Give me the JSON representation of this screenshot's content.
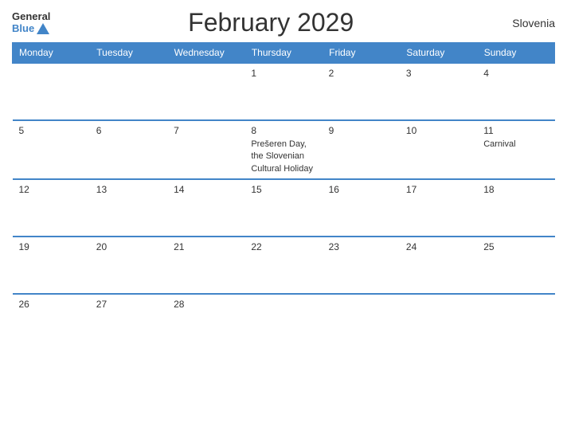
{
  "header": {
    "logo": {
      "general": "General",
      "blue": "Blue"
    },
    "title": "February 2029",
    "country": "Slovenia"
  },
  "calendar": {
    "days_of_week": [
      "Monday",
      "Tuesday",
      "Wednesday",
      "Thursday",
      "Friday",
      "Saturday",
      "Sunday"
    ],
    "weeks": [
      [
        {
          "day": "",
          "empty": true
        },
        {
          "day": "",
          "empty": true
        },
        {
          "day": "",
          "empty": true
        },
        {
          "day": "1",
          "empty": false,
          "event": ""
        },
        {
          "day": "2",
          "empty": false,
          "event": ""
        },
        {
          "day": "3",
          "empty": false,
          "event": ""
        },
        {
          "day": "4",
          "empty": false,
          "event": ""
        }
      ],
      [
        {
          "day": "5",
          "empty": false,
          "event": ""
        },
        {
          "day": "6",
          "empty": false,
          "event": ""
        },
        {
          "day": "7",
          "empty": false,
          "event": ""
        },
        {
          "day": "8",
          "empty": false,
          "event": "Prešeren Day, the Slovenian Cultural Holiday"
        },
        {
          "day": "9",
          "empty": false,
          "event": ""
        },
        {
          "day": "10",
          "empty": false,
          "event": ""
        },
        {
          "day": "11",
          "empty": false,
          "event": "Carnival"
        }
      ],
      [
        {
          "day": "12",
          "empty": false,
          "event": ""
        },
        {
          "day": "13",
          "empty": false,
          "event": ""
        },
        {
          "day": "14",
          "empty": false,
          "event": ""
        },
        {
          "day": "15",
          "empty": false,
          "event": ""
        },
        {
          "day": "16",
          "empty": false,
          "event": ""
        },
        {
          "day": "17",
          "empty": false,
          "event": ""
        },
        {
          "day": "18",
          "empty": false,
          "event": ""
        }
      ],
      [
        {
          "day": "19",
          "empty": false,
          "event": ""
        },
        {
          "day": "20",
          "empty": false,
          "event": ""
        },
        {
          "day": "21",
          "empty": false,
          "event": ""
        },
        {
          "day": "22",
          "empty": false,
          "event": ""
        },
        {
          "day": "23",
          "empty": false,
          "event": ""
        },
        {
          "day": "24",
          "empty": false,
          "event": ""
        },
        {
          "day": "25",
          "empty": false,
          "event": ""
        }
      ],
      [
        {
          "day": "26",
          "empty": false,
          "event": ""
        },
        {
          "day": "27",
          "empty": false,
          "event": ""
        },
        {
          "day": "28",
          "empty": false,
          "event": ""
        },
        {
          "day": "",
          "empty": true
        },
        {
          "day": "",
          "empty": true
        },
        {
          "day": "",
          "empty": true
        },
        {
          "day": "",
          "empty": true
        }
      ]
    ]
  }
}
